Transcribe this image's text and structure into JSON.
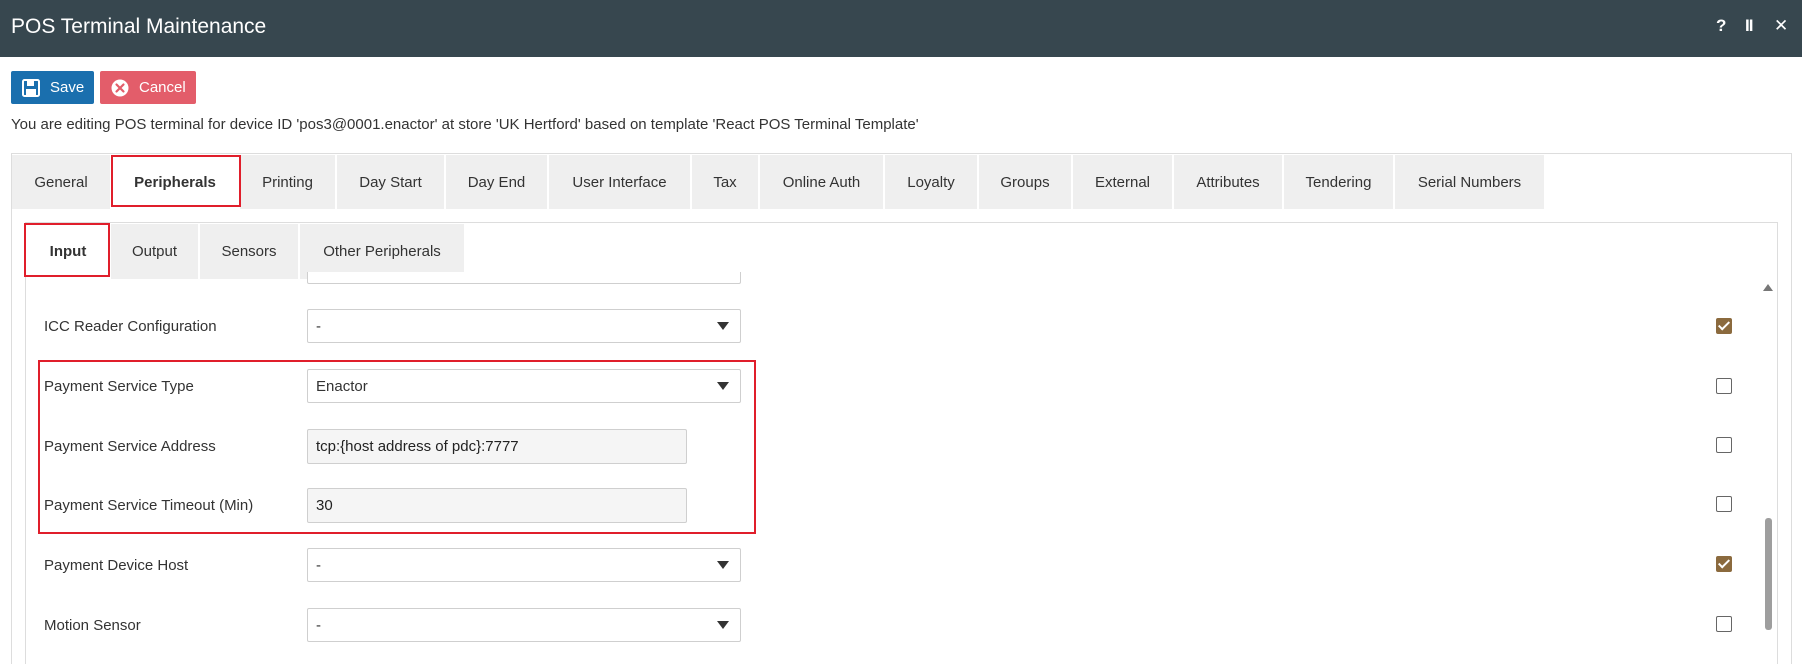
{
  "window": {
    "title": "POS Terminal Maintenance",
    "controls": {
      "help": "?",
      "pause": "II",
      "close": "✕"
    }
  },
  "toolbar": {
    "save_label": "Save",
    "cancel_label": "Cancel",
    "save_icon": "floppy-disk-icon",
    "cancel_icon": "x-circle-icon"
  },
  "info_text": "You are editing POS terminal for device ID 'pos3@0001.enactor' at store 'UK Hertford' based on template 'React POS Terminal Template'",
  "tabs": [
    {
      "label": "General"
    },
    {
      "label": "Peripherals",
      "active": true
    },
    {
      "label": "Printing"
    },
    {
      "label": "Day Start"
    },
    {
      "label": "Day End"
    },
    {
      "label": "User Interface"
    },
    {
      "label": "Tax"
    },
    {
      "label": "Online Auth"
    },
    {
      "label": "Loyalty"
    },
    {
      "label": "Groups"
    },
    {
      "label": "External"
    },
    {
      "label": "Attributes"
    },
    {
      "label": "Tendering"
    },
    {
      "label": "Serial Numbers"
    }
  ],
  "subtabs": [
    {
      "label": "Input",
      "active": true
    },
    {
      "label": "Output"
    },
    {
      "label": "Sensors"
    },
    {
      "label": "Other Peripherals"
    }
  ],
  "fields": [
    {
      "label": "ICC Reader Configuration",
      "type": "select",
      "value": "-",
      "checked": true
    },
    {
      "label": "Payment Service Type",
      "type": "select",
      "value": "Enactor",
      "checked": false
    },
    {
      "label": "Payment Service Address",
      "type": "text",
      "value": "tcp:{host address of pdc}:7777",
      "checked": false
    },
    {
      "label": "Payment Service Timeout (Min)",
      "type": "text",
      "value": "30",
      "checked": false
    },
    {
      "label": "Payment Device Host",
      "type": "select",
      "value": "-",
      "checked": true
    },
    {
      "label": "Motion Sensor",
      "type": "select",
      "value": "-",
      "checked": false
    }
  ],
  "colors": {
    "titlebar": "#37474f",
    "save": "#1a6fae",
    "cancel": "#e35d6a",
    "highlight": "#e01e2b",
    "checkbox_checked": "#8b6a3e"
  }
}
